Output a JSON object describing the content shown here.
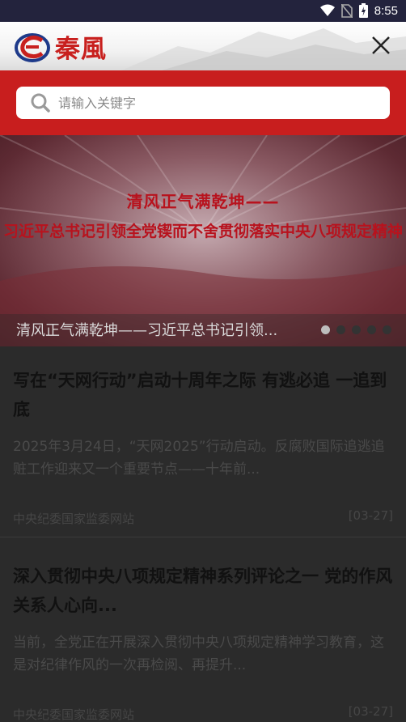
{
  "status_bar": {
    "time": "8:55"
  },
  "header": {
    "logo_text": "秦風"
  },
  "search": {
    "placeholder": "请输入关键字"
  },
  "banner": {
    "title_line1": "清风正气满乾坤——",
    "title_line2": "习近平总书记引领全党锲而不舍贯彻落实中央八项规定精神",
    "caption": "清风正气满乾坤——习近平总书记引领...",
    "slide_count": 5,
    "active_slide": 1
  },
  "articles": [
    {
      "title": "写在“天网行动”启动十周年之际 有逃必追 一追到底",
      "summary": "2025年3月24日，“天网2025”行动启动。反腐败国际追逃追赃工作迎来又一个重要节点——十年前...",
      "source": "中央纪委国家监委网站",
      "date": "[03-27]"
    },
    {
      "title": "深入贯彻中央八项规定精神系列评论之一 党的作风关系人心向...",
      "summary": "当前，全党正在开展深入贯彻中央八项规定精神学习教育，这是对纪律作风的一次再检阅、再提升...",
      "source": "中央纪委国家监委网站",
      "date": "[03-27]"
    }
  ]
}
